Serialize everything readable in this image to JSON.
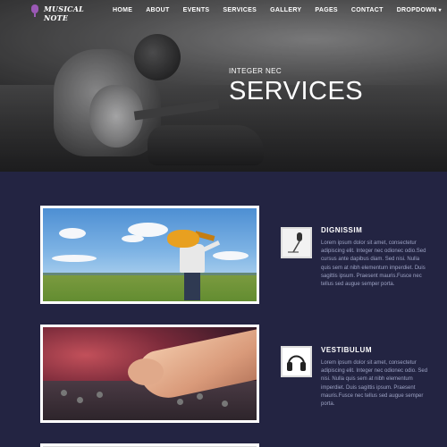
{
  "nav": {
    "logo_line1": "MUSICAL",
    "logo_line2": "NOTE",
    "links": [
      "HOME",
      "ABOUT",
      "EVENTS",
      "SERVICES",
      "GALLERY",
      "PAGES",
      "CONTACT",
      "DROPDOWN"
    ]
  },
  "hero": {
    "subtitle": "INTEGER NEC",
    "title": "SERVICES"
  },
  "services": [
    {
      "title": "DIGNISSIM",
      "icon": "microphone-icon",
      "text": "Lorem ipsum dolor sit amet, consectetur adipiscing elit. Integer nec odionec odio.Sed cursus ante dapibus diam. Sed nisi. Nulla quis sem at nibh elementum imperdiet. Duis sagittis ipsum. Praesent mauris.Fusce nec tellus sed augue semper porta."
    },
    {
      "title": "VESTIBULUM",
      "icon": "headphones-icon",
      "text": "Lorem ipsum dolor sit amet, consectetur adipiscing elit. Integer nec odionec odio. Sed nisi. Nulla quis sem at nibh elementum imperdiet. Duis sagittis ipsum. Praesent mauris.Fusce nec tellus sed augue semper porta."
    }
  ],
  "colors": {
    "background": "#232442",
    "logo_accent": "#9b59b6",
    "body_text": "#9da3c4"
  }
}
